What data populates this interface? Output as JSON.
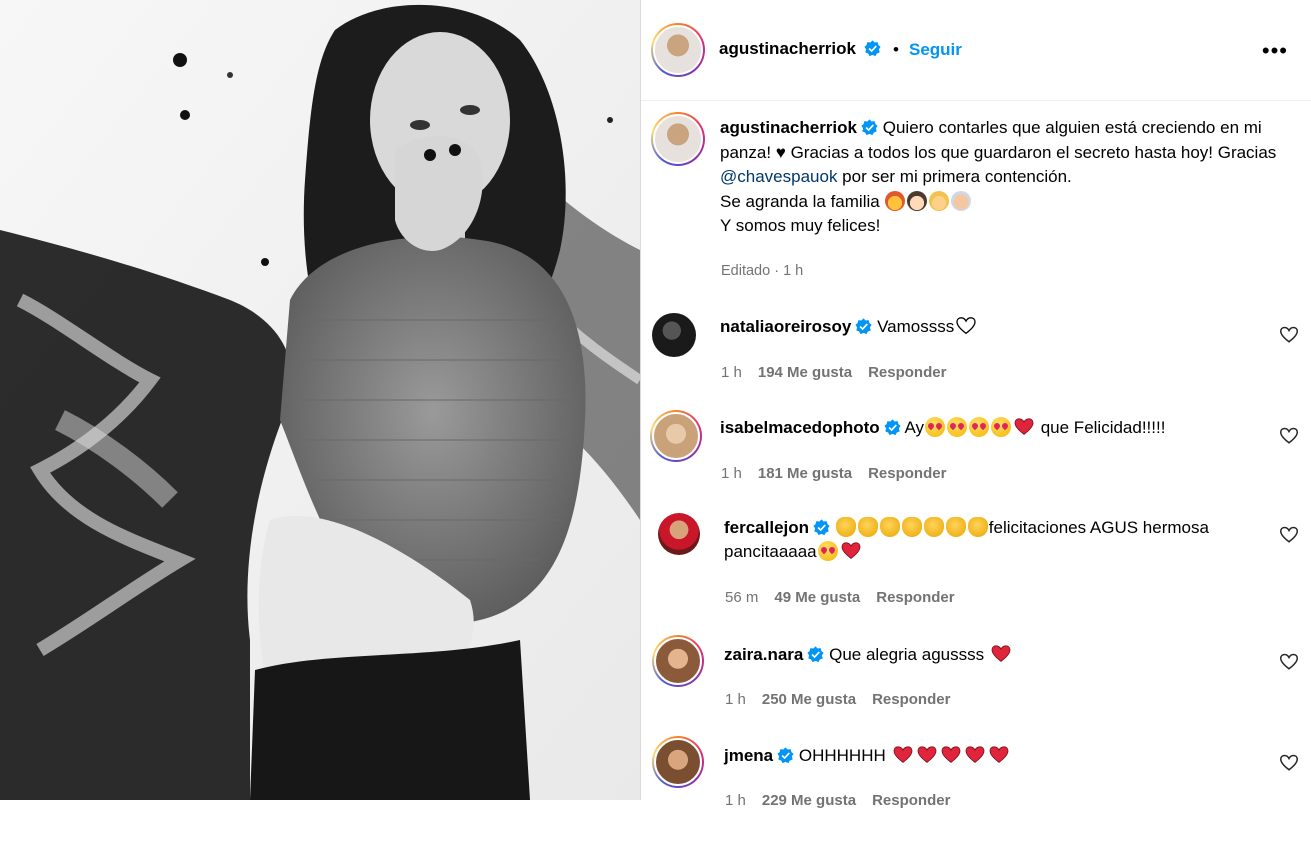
{
  "post": {
    "author": "agustinacherriok",
    "follow_label": "Seguir",
    "separator": "•",
    "more_label": "•••",
    "caption_author": "agustinacherriok",
    "caption_part1": "Quiero contarles que alguien está creciendo en mi panza! ♥ Gracias a todos los que guardaron el secreto hasta hoy! Gracias ",
    "caption_mention": "@chavespauok",
    "caption_part2": " por ser mi primera contención.",
    "caption_line2": "Se agranda la familia",
    "caption_line3": "Y somos muy felices!",
    "caption_meta": "Editado · 1 h"
  },
  "comments": [
    {
      "user": "nataliaoreirosoy",
      "text": "Vamossss",
      "time": "1 h",
      "likes": "194 Me gusta",
      "reply": "Responder"
    },
    {
      "user": "isabelmacedophoto",
      "text_a": "Ay",
      "text_b": "que Felicidad!!!!!",
      "time": "1 h",
      "likes": "181 Me gusta",
      "reply": "Responder"
    },
    {
      "user": "fercallejon",
      "text_a": "felicitaciones AGUS hermosa pancitaaaaa",
      "time": "56 m",
      "likes": "49 Me gusta",
      "reply": "Responder"
    },
    {
      "user": "zaira.nara",
      "text": "Que alegria agussss",
      "time": "1 h",
      "likes": "250 Me gusta",
      "reply": "Responder"
    },
    {
      "user": "jmena",
      "text": "OHHHHHH",
      "time": "1 h",
      "likes": "229 Me gusta",
      "reply": "Responder"
    }
  ],
  "colors": {
    "link": "#0095f6",
    "mention": "#00376b",
    "muted": "#737373",
    "verified": "#0095f6"
  }
}
